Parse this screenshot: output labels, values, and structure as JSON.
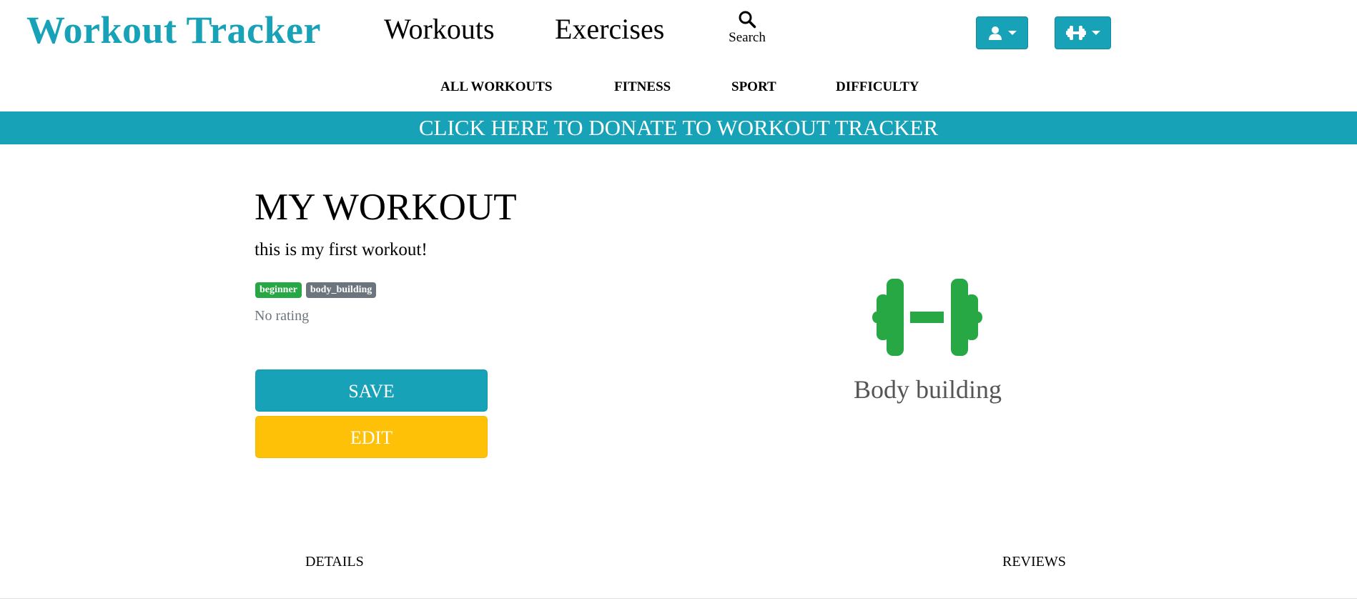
{
  "header": {
    "brand": "Workout Tracker",
    "nav": {
      "workouts": "Workouts",
      "exercises": "Exercises",
      "search": "Search"
    },
    "icons": {
      "search": "search-icon",
      "user": "user-icon",
      "dumbbell": "dumbbell-icon",
      "caret": "caret-down-icon"
    }
  },
  "subnav": {
    "items": [
      "ALL WORKOUTS",
      "FITNESS",
      "SPORT",
      "DIFFICULTY"
    ]
  },
  "donate_banner": "CLICK HERE TO DONATE TO WORKOUT TRACKER",
  "workout": {
    "title": "MY WORKOUT",
    "description": "this is my first workout!",
    "tags": [
      "beginner",
      "body_building"
    ],
    "rating": "No rating",
    "save_label": "SAVE",
    "edit_label": "EDIT",
    "type_label": "Body building",
    "type_icon": "dumbbell-icon"
  },
  "tabs": [
    "DETAILS",
    "REVIEWS"
  ],
  "colors": {
    "primary": "#17a2b8",
    "warning": "#ffc107",
    "success": "#28a745",
    "secondary": "#6c757d"
  }
}
